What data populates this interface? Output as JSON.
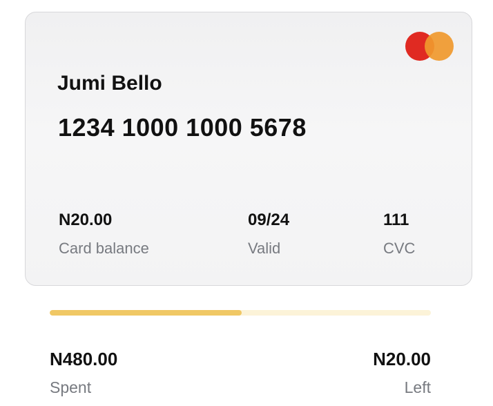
{
  "card": {
    "holder_name": "Jumi Bello",
    "number": "1234 1000 1000 5678",
    "brand_icon": "mastercard-logo",
    "balance": {
      "value": "N20.00",
      "label": "Card balance"
    },
    "valid": {
      "value": "09/24",
      "label": "Valid"
    },
    "cvc": {
      "value": "111",
      "label": "CVC"
    }
  },
  "usage": {
    "progress_fraction": 0.504,
    "spent": {
      "value": "N480.00",
      "label": "Spent"
    },
    "left": {
      "value": "N20.00",
      "label": "Left"
    }
  },
  "colors": {
    "progress_fill": "#f0c865",
    "progress_track": "#fcf3d8",
    "mastercard_red": "#e02a22",
    "mastercard_orange": "#f0992e"
  }
}
